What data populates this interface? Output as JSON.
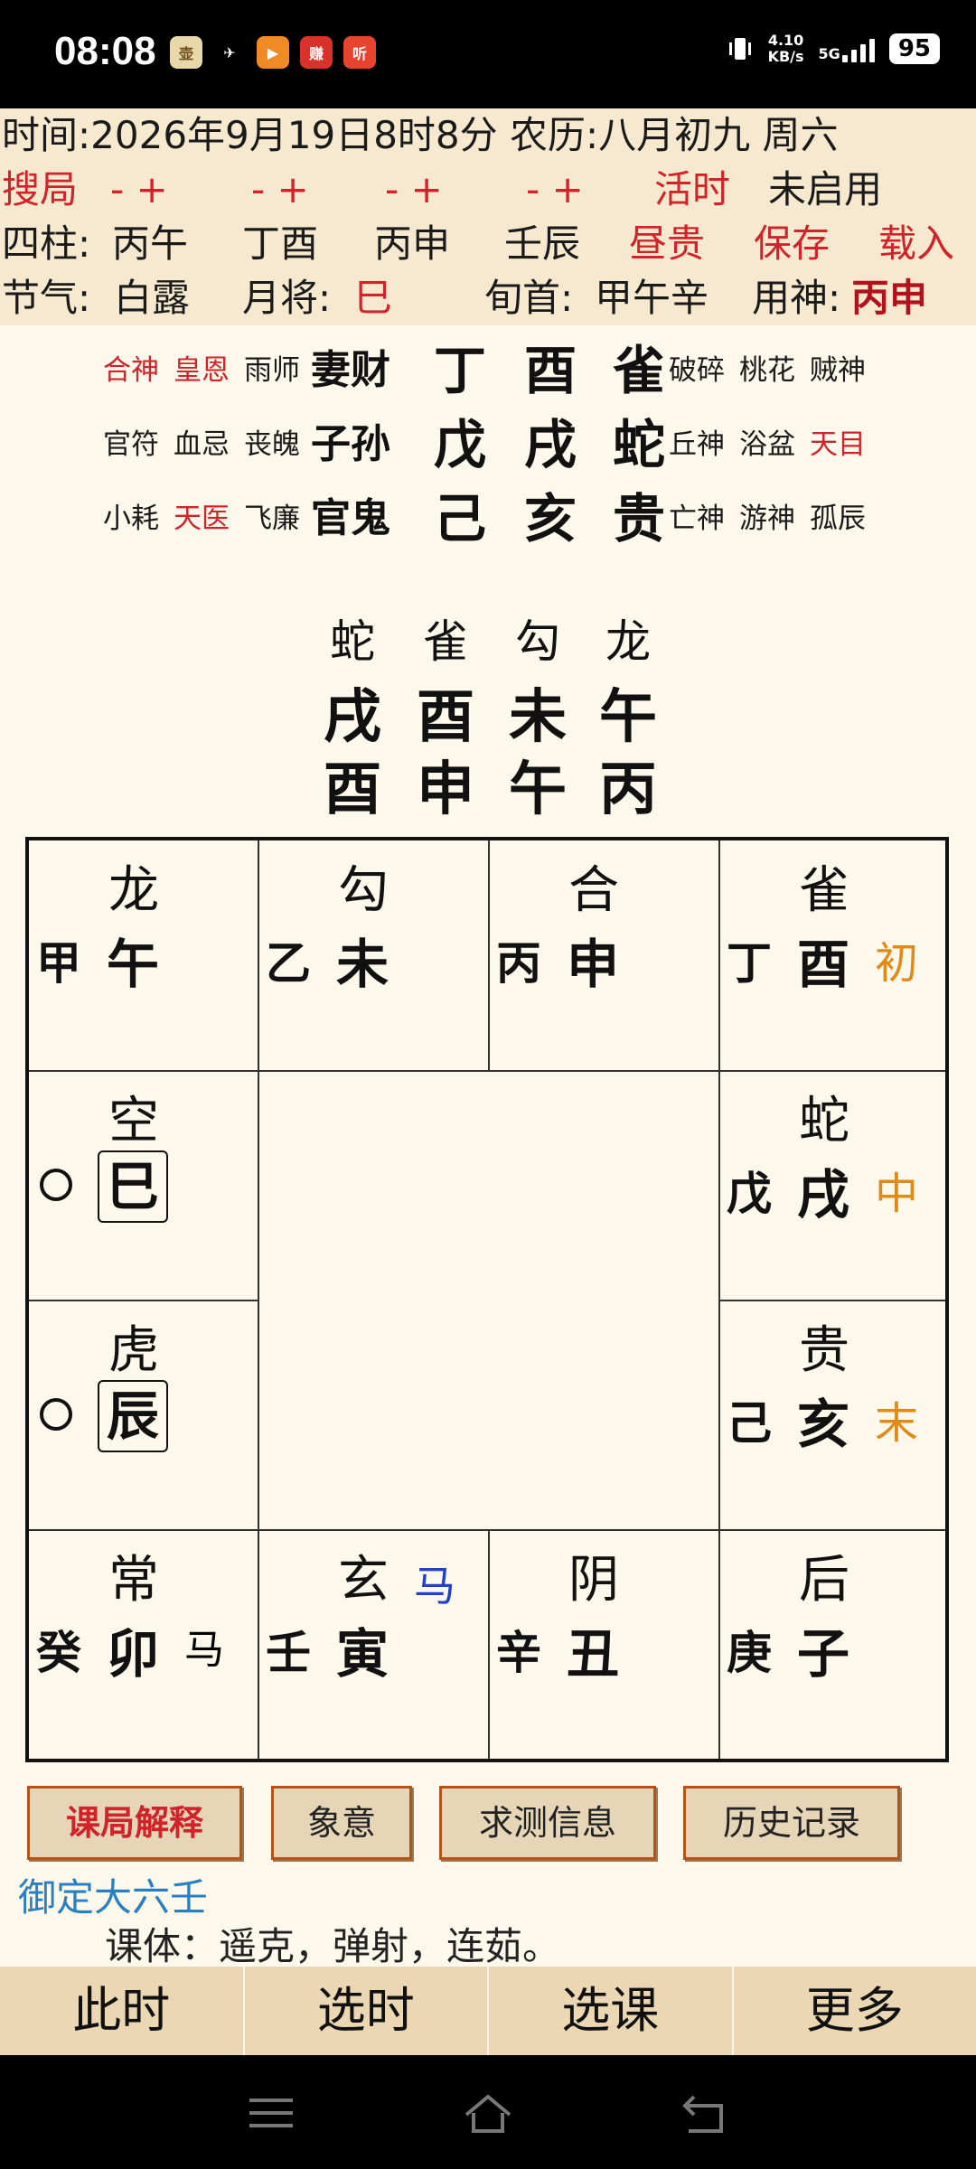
{
  "status_bar": {
    "time": "08:08",
    "apps": [
      {
        "icon": "liuren-app-icon",
        "color": "#e8d7a8",
        "text": "壶"
      },
      {
        "icon": "bird-app-icon",
        "color": "#000000",
        "text": "✈"
      },
      {
        "icon": "video-app-icon",
        "color": "#f08a24",
        "text": "▶"
      },
      {
        "icon": "red-app-icon",
        "color": "#d8322a",
        "text": "赚"
      },
      {
        "icon": "listen-app-icon",
        "color": "#e8432e",
        "text": "听"
      }
    ],
    "net_speed": "4.10",
    "net_unit": "KB/s",
    "network": "5G",
    "battery": "95"
  },
  "info": {
    "time_line": "时间:2026年9月19日8时8分 农历:八月初九 周六",
    "search_label": "搜局",
    "pm_groups": [
      "- +",
      "- +",
      "- +",
      "- +"
    ],
    "live_time": "活时",
    "not_enabled": "未启用",
    "pillars_label": "四柱:",
    "pillars": [
      "丙午",
      "丁酉",
      "丙申",
      "壬辰"
    ],
    "day_noble": "昼贵",
    "save": "保存",
    "load": "载入",
    "solar_term_label": "节气:",
    "solar_term": "白露",
    "month_general_label": "月将:",
    "month_general": "巳",
    "xun_label": "旬首:",
    "xun": "甲午辛",
    "use_god_label": "用神:",
    "use_god": "丙申"
  },
  "san_chuan": [
    {
      "left": [
        "合神",
        "皇恩",
        "雨师"
      ],
      "left_colors": [
        "#d1232a",
        "#d1232a",
        "#1a1a1a"
      ],
      "six_kin": "妻财",
      "stem": "丁",
      "branch": "酉",
      "general": "雀",
      "right": [
        "破碎",
        "桃花",
        "贼神"
      ],
      "right_colors": [
        "#1a1a1a",
        "#1a1a1a",
        "#1a1a1a"
      ]
    },
    {
      "left": [
        "官符",
        "血忌",
        "丧魄"
      ],
      "left_colors": [
        "#1a1a1a",
        "#1a1a1a",
        "#1a1a1a"
      ],
      "six_kin": "子孙",
      "stem": "戊",
      "branch": "戌",
      "general": "蛇",
      "right": [
        "丘神",
        "浴盆",
        "天目"
      ],
      "right_colors": [
        "#1a1a1a",
        "#1a1a1a",
        "#d1232a"
      ]
    },
    {
      "left": [
        "小耗",
        "天医",
        "飞廉"
      ],
      "left_colors": [
        "#1a1a1a",
        "#d1232a",
        "#1a1a1a"
      ],
      "six_kin": "官鬼",
      "stem": "己",
      "branch": "亥",
      "general": "贵",
      "right": [
        "亡神",
        "游神",
        "孤辰"
      ],
      "right_colors": [
        "#1a1a1a",
        "#1a1a1a",
        "#1a1a1a"
      ]
    }
  ],
  "si_ke": {
    "generals": [
      "蛇",
      "雀",
      "勾",
      "龙"
    ],
    "upper": [
      "戌",
      "酉",
      "未",
      "午"
    ],
    "lower": [
      "酉",
      "申",
      "午",
      "丙"
    ]
  },
  "plate": {
    "top": [
      {
        "general": "龙",
        "stem": "甲",
        "branch": "午",
        "mark": ""
      },
      {
        "general": "勾",
        "stem": "乙",
        "branch": "未",
        "mark": ""
      },
      {
        "general": "合",
        "stem": "丙",
        "branch": "申",
        "mark": ""
      },
      {
        "general": "雀",
        "stem": "丁",
        "branch": "酉",
        "mark": "初"
      }
    ],
    "left": [
      {
        "general": "空",
        "branch": "巳"
      },
      {
        "general": "虎",
        "branch": "辰"
      }
    ],
    "right": [
      {
        "general": "蛇",
        "stem": "戊",
        "branch": "戌",
        "mark": "中"
      },
      {
        "general": "贵",
        "stem": "己",
        "branch": "亥",
        "mark": "末"
      }
    ],
    "bottom": [
      {
        "general": "常",
        "stem": "癸",
        "branch": "卯",
        "mark": "马"
      },
      {
        "general": "玄",
        "stem": "壬",
        "branch": "寅",
        "mark": "马"
      },
      {
        "general": "阴",
        "stem": "辛",
        "branch": "丑",
        "mark": ""
      },
      {
        "general": "后",
        "stem": "庚",
        "branch": "子",
        "mark": ""
      }
    ]
  },
  "buttons": [
    "课局解释",
    "象意",
    "求测信息",
    "历史记录"
  ],
  "brand": "御定大六壬",
  "keti": "课体：遥克，弹射，连茹。",
  "tabs": [
    "此时",
    "选时",
    "选课",
    "更多"
  ]
}
